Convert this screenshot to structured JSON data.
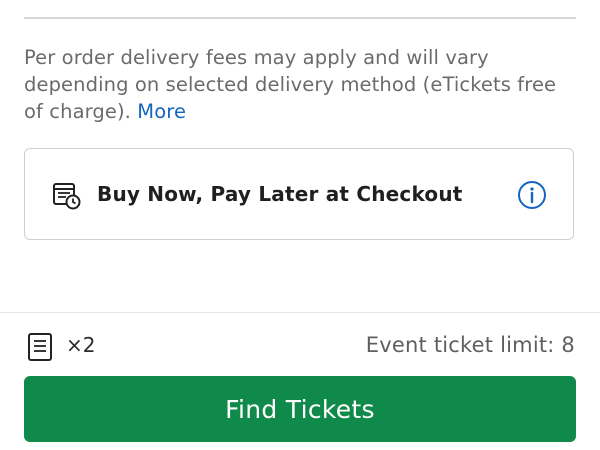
{
  "delivery_note": {
    "text": "Per order delivery fees may apply and will vary depending on selected delivery method (eTickets free of charge).",
    "more_link": "More"
  },
  "bnpl": {
    "label": "Buy Now, Pay Later at Checkout",
    "icon": "calendar-payment-icon",
    "info_icon": "info-icon"
  },
  "tickets": {
    "icon": "ticket-icon",
    "quantity": "×2",
    "limit_text": "Event ticket limit: 8"
  },
  "cta": {
    "label": "Find Tickets"
  },
  "colors": {
    "accent": "#0f8a4a",
    "link": "#1565c0"
  }
}
